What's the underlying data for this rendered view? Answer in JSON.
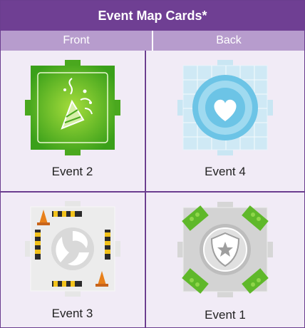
{
  "table": {
    "title": "Event Map Cards*",
    "columns": [
      "Front",
      "Back"
    ],
    "cards": [
      {
        "label": "Event 2",
        "icon": "party-popper-icon",
        "color": "#4caf1e"
      },
      {
        "label": "Event 4",
        "icon": "heart-icon",
        "color": "#bfe3f4"
      },
      {
        "label": "Event 3",
        "icon": "swirl-icon",
        "color": "#e4e4e4"
      },
      {
        "label": "Event 1",
        "icon": "shield-star-icon",
        "color": "#d0d0d0"
      }
    ]
  }
}
